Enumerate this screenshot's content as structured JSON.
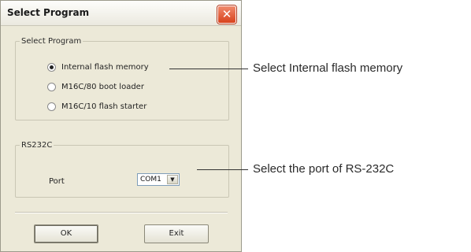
{
  "dialog": {
    "title": "Select Program",
    "close_glyph": "✕",
    "program_group": {
      "legend": "Select Program",
      "options": [
        {
          "label": "Internal flash memory",
          "selected": true
        },
        {
          "label": "M16C/80 boot loader",
          "selected": false
        },
        {
          "label": "M16C/10 flash starter",
          "selected": false
        }
      ]
    },
    "rs232c_group": {
      "legend": "RS232C",
      "port_label": "Port",
      "port_value": "COM1",
      "dropdown_glyph": "▼"
    },
    "buttons": {
      "ok_label": "OK",
      "exit_label": "Exit"
    }
  },
  "annotations": {
    "program": "Select Internal flash memory",
    "port": "Select the port of RS-232C"
  },
  "colors": {
    "dialog_bg": "#ece9d8",
    "close_button": "#d8421c",
    "field_border": "#7f9db9"
  },
  "icons": {
    "close": "close-icon",
    "dropdown": "chevron-down-icon"
  }
}
